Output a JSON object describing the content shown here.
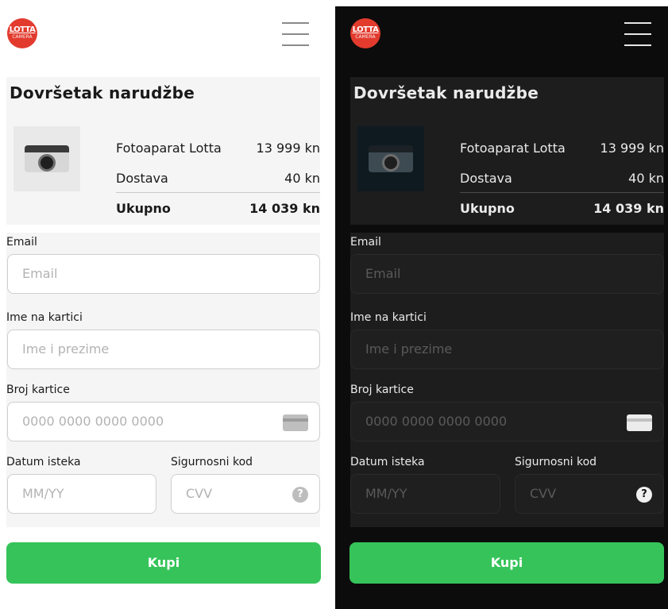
{
  "app": {
    "logo_top": "LOTTA",
    "logo_bottom": "CAMERA"
  },
  "order": {
    "title": "Dovršetak narudžbe",
    "items": [
      {
        "label": "Fotoaparat Lotta",
        "value": "13 999 kn"
      },
      {
        "label": "Dostava",
        "value": "40 kn"
      }
    ],
    "total": {
      "label": "Ukupno",
      "value": "14 039 kn"
    }
  },
  "form": {
    "email": {
      "label": "Email",
      "placeholder": "Email"
    },
    "name": {
      "label": "Ime na kartici",
      "placeholder": "Ime i prezime"
    },
    "card": {
      "label": "Broj kartice",
      "placeholder": "0000 0000 0000 0000"
    },
    "expiry": {
      "label": "Datum isteka",
      "placeholder": "MM/YY"
    },
    "cvv": {
      "label": "Sigurnosni kod",
      "placeholder": "CVV"
    }
  },
  "buy_label": "Kupi",
  "icons": {
    "menu": "hamburger-icon",
    "card": "credit-card-icon",
    "help": "question-circle-icon",
    "product": "camera-photo"
  },
  "colors": {
    "accent": "#36c45a",
    "logo": "#e23b2e",
    "light_bg": "#ffffff",
    "dark_bg": "#0c0c0c"
  }
}
